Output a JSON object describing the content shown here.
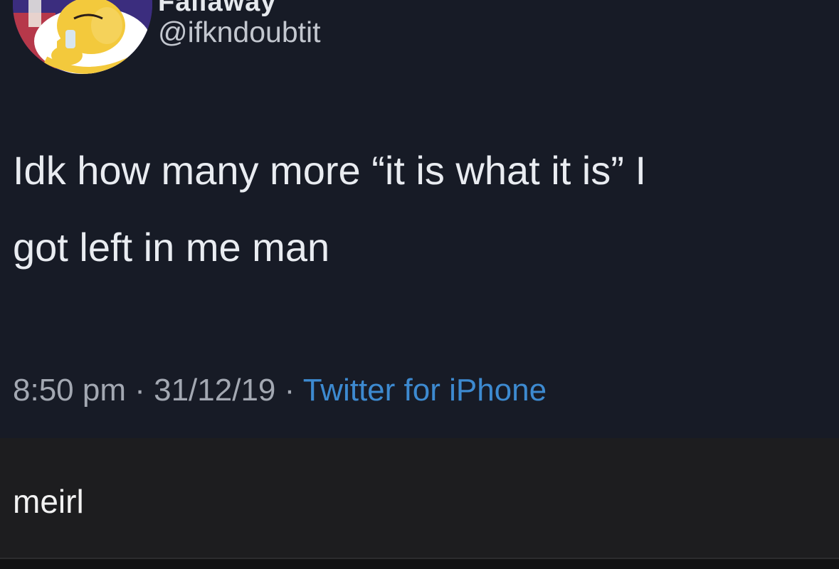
{
  "tweet": {
    "display_name": "Fallaway",
    "handle": "@ifkndoubtit",
    "text_line1": "Idk how many more “it is what it is” I",
    "text_line2": "got left in me man",
    "time": "8:50 pm",
    "separator": "·",
    "date": "31/12/19",
    "source": "Twitter for iPhone",
    "avatar_icon": "cartoon-character-avatar"
  },
  "post": {
    "caption": "meirl"
  },
  "colors": {
    "tweet_background": "#171b26",
    "text": "#e9ecf1",
    "meta_text": "#a3a8b2",
    "source_link": "#3d8ad0",
    "caption_background": "#1d1d1f"
  }
}
